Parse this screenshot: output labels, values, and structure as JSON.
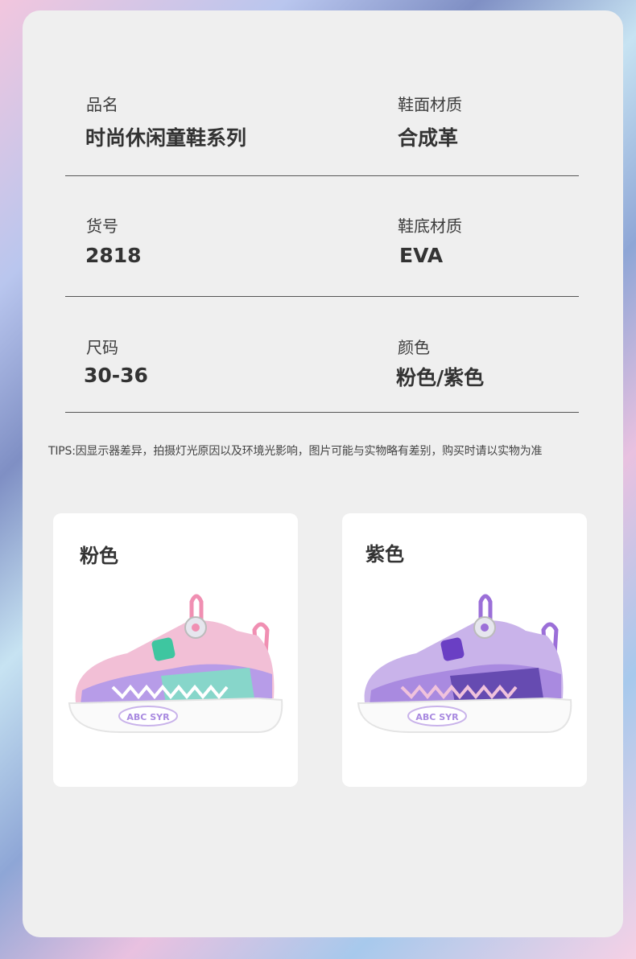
{
  "specs": [
    {
      "label": "品名",
      "value": "时尚休闲童鞋系列"
    },
    {
      "label": "鞋面材质",
      "value": "合成革"
    },
    {
      "label": "货号",
      "value": "2818"
    },
    {
      "label": "鞋底材质",
      "value": "EVA"
    },
    {
      "label": "尺码",
      "value": "30-36"
    },
    {
      "label": "颜色",
      "value": "粉色/紫色"
    }
  ],
  "tips": "TIPS:因显示器差异，拍摄灯光原因以及环境光影响，图片可能与实物略有差别，购买时请以实物为准",
  "products": [
    {
      "name": "粉色",
      "logo": "ABC SYR",
      "colors": {
        "upper": "#f2bfd6",
        "accent": "#b79ce8",
        "mesh": "#7fe0c4",
        "loop": "#f08fb2"
      }
    },
    {
      "name": "紫色",
      "logo": "ABC SYR",
      "colors": {
        "upper": "#c9b3ea",
        "accent": "#a98ae0",
        "mesh": "#5b3fa8",
        "loop": "#9b6fd8"
      }
    }
  ]
}
